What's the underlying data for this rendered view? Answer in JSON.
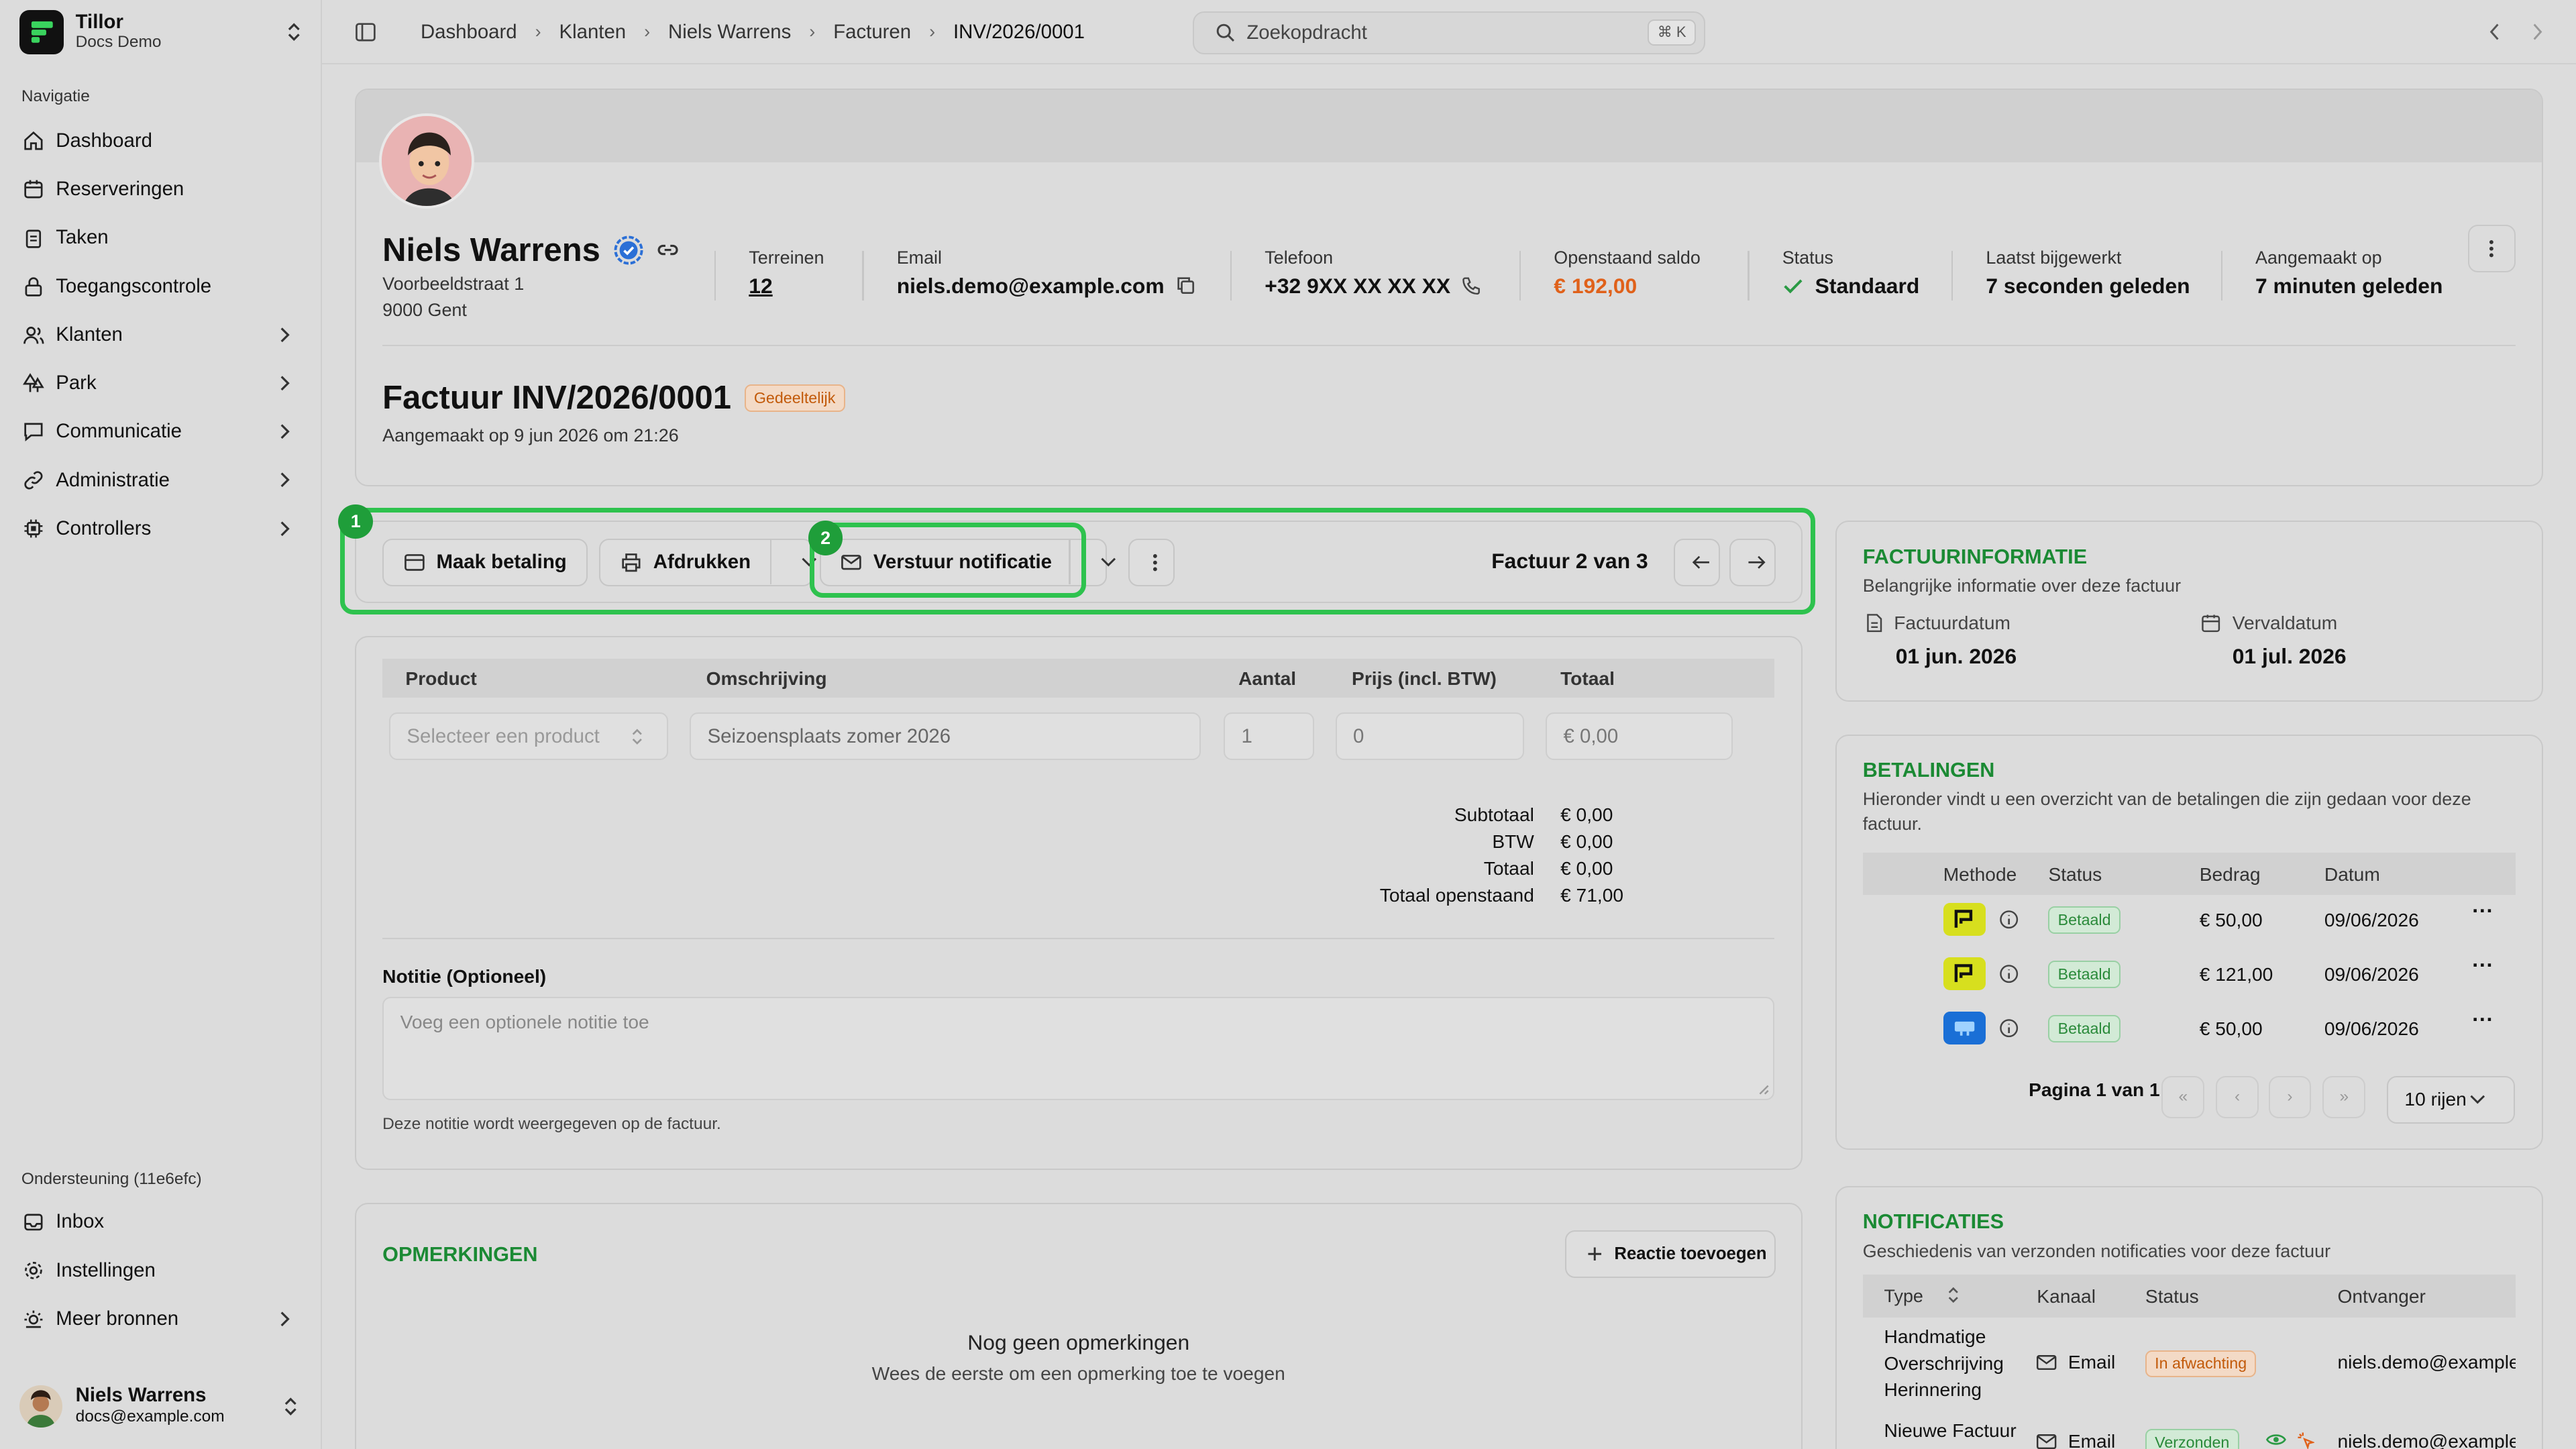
{
  "sidebar": {
    "brand": {
      "name": "Tillor",
      "sub": "Docs Demo"
    },
    "nav_heading": "Navigatie",
    "nav": [
      {
        "label": "Dashboard",
        "icon": "home-icon"
      },
      {
        "label": "Reserveringen",
        "icon": "calendar-icon"
      },
      {
        "label": "Taken",
        "icon": "clipboard-icon"
      },
      {
        "label": "Toegangscontrole",
        "icon": "lock-icon"
      },
      {
        "label": "Klanten",
        "icon": "users-icon"
      },
      {
        "label": "Park",
        "icon": "trees-icon"
      },
      {
        "label": "Communicatie",
        "icon": "message-icon"
      },
      {
        "label": "Administratie",
        "icon": "link-icon"
      },
      {
        "label": "Controllers",
        "icon": "cpu-icon"
      }
    ],
    "support_heading": "Ondersteuning (11e6efc)",
    "support": [
      {
        "label": "Inbox",
        "icon": "inbox-icon"
      },
      {
        "label": "Instellingen",
        "icon": "gear-icon"
      },
      {
        "label": "Meer bronnen",
        "icon": "sun-icon"
      }
    ],
    "user": {
      "name": "Niels Warrens",
      "email": "docs@example.com"
    }
  },
  "breadcrumb": [
    "Dashboard",
    "Klanten",
    "Niels Warrens",
    "Facturen",
    "INV/2026/0001"
  ],
  "search": {
    "placeholder": "Zoekopdracht",
    "shortcut": "⌘ K"
  },
  "customer": {
    "name": "Niels Warrens",
    "street": "Voorbeeldstraat 1",
    "city": "9000 Gent",
    "stats": {
      "terreinen": {
        "label": "Terreinen",
        "value": "12"
      },
      "email": {
        "label": "Email",
        "value": "niels.demo@example.com"
      },
      "telefoon": {
        "label": "Telefoon",
        "value": "+32 9XX XX XX XX"
      },
      "saldo": {
        "label": "Openstaand saldo",
        "value": "€ 192,00"
      },
      "status": {
        "label": "Status",
        "value": "Standaard"
      },
      "updated": {
        "label": "Laatst bijgewerkt",
        "value": "7 seconden geleden"
      },
      "created": {
        "label": "Aangemaakt op",
        "value": "7 minuten geleden"
      }
    }
  },
  "invoice": {
    "title": "Factuur INV/2026/0001",
    "badge": "Gedeeltelijk",
    "created": "Aangemaakt op 9 jun 2026 om 21:26"
  },
  "toolbar": {
    "pay": "Maak betaling",
    "print": "Afdrukken",
    "notify": "Verstuur notificatie",
    "counter": "Factuur 2 van 3",
    "marker1": "1",
    "marker2": "2"
  },
  "lines": {
    "headers": [
      "Product",
      "Omschrijving",
      "Aantal",
      "Prijs (incl. BTW)",
      "Totaal"
    ],
    "product_placeholder": "Selecteer een product",
    "description": "Seizoensplaats zomer 2026",
    "qty": "1",
    "price": "0",
    "total": "€ 0,00",
    "totals": [
      {
        "label": "Subtotaal",
        "value": "€ 0,00"
      },
      {
        "label": "BTW",
        "value": "€ 0,00"
      },
      {
        "label": "Totaal",
        "value": "€ 0,00"
      },
      {
        "label": "Totaal openstaand",
        "value": "€ 71,00"
      }
    ],
    "note_label": "Notitie (Optioneel)",
    "note_placeholder": "Voeg een optionele notitie toe",
    "note_hint": "Deze notitie wordt weergegeven op de factuur."
  },
  "remarks": {
    "title": "OPMERKINGEN",
    "add": "Reactie toevoegen",
    "empty_title": "Nog geen opmerkingen",
    "empty_sub": "Wees de eerste om een opmerking toe te voegen"
  },
  "info": {
    "title": "FACTUURINFORMATIE",
    "sub": "Belangrijke informatie over deze factuur",
    "date_label": "Factuurdatum",
    "date": "01 jun. 2026",
    "due_label": "Vervaldatum",
    "due": "01 jul. 2026"
  },
  "payments": {
    "title": "BETALINGEN",
    "sub": "Hieronder vindt u een overzicht van de betalingen die zijn gedaan voor deze factuur.",
    "headers": [
      "Methode",
      "Status",
      "Bedrag",
      "Datum"
    ],
    "rows": [
      {
        "status": "Betaald",
        "amount": "€ 50,00",
        "date": "09/06/2026",
        "method_color": "#d7df1e"
      },
      {
        "status": "Betaald",
        "amount": "€ 121,00",
        "date": "09/06/2026",
        "method_color": "#d7df1e"
      },
      {
        "status": "Betaald",
        "amount": "€ 50,00",
        "date": "09/06/2026",
        "method_color": "#1a6fd6"
      }
    ],
    "pager": "Pagina 1 van 1",
    "rows_select": "10 rijen"
  },
  "notifications": {
    "title": "NOTIFICATIES",
    "sub": "Geschiedenis van verzonden notificaties voor deze factuur",
    "headers": [
      "Type",
      "Kanaal",
      "Status",
      "Ontvanger"
    ],
    "rows": [
      {
        "type": "Handmatige Overschrijving Herinnering",
        "channel": "Email",
        "status": "In afwachting",
        "recipient": "niels.demo@example.com"
      },
      {
        "type": "Nieuwe Factuur",
        "channel": "Email",
        "status": "Verzonden",
        "recipient": "niels.demo@example.com"
      }
    ]
  },
  "colors": {
    "accent": "#1b8a34",
    "highlight": "#2ec24e",
    "warning": "#e0611a"
  }
}
